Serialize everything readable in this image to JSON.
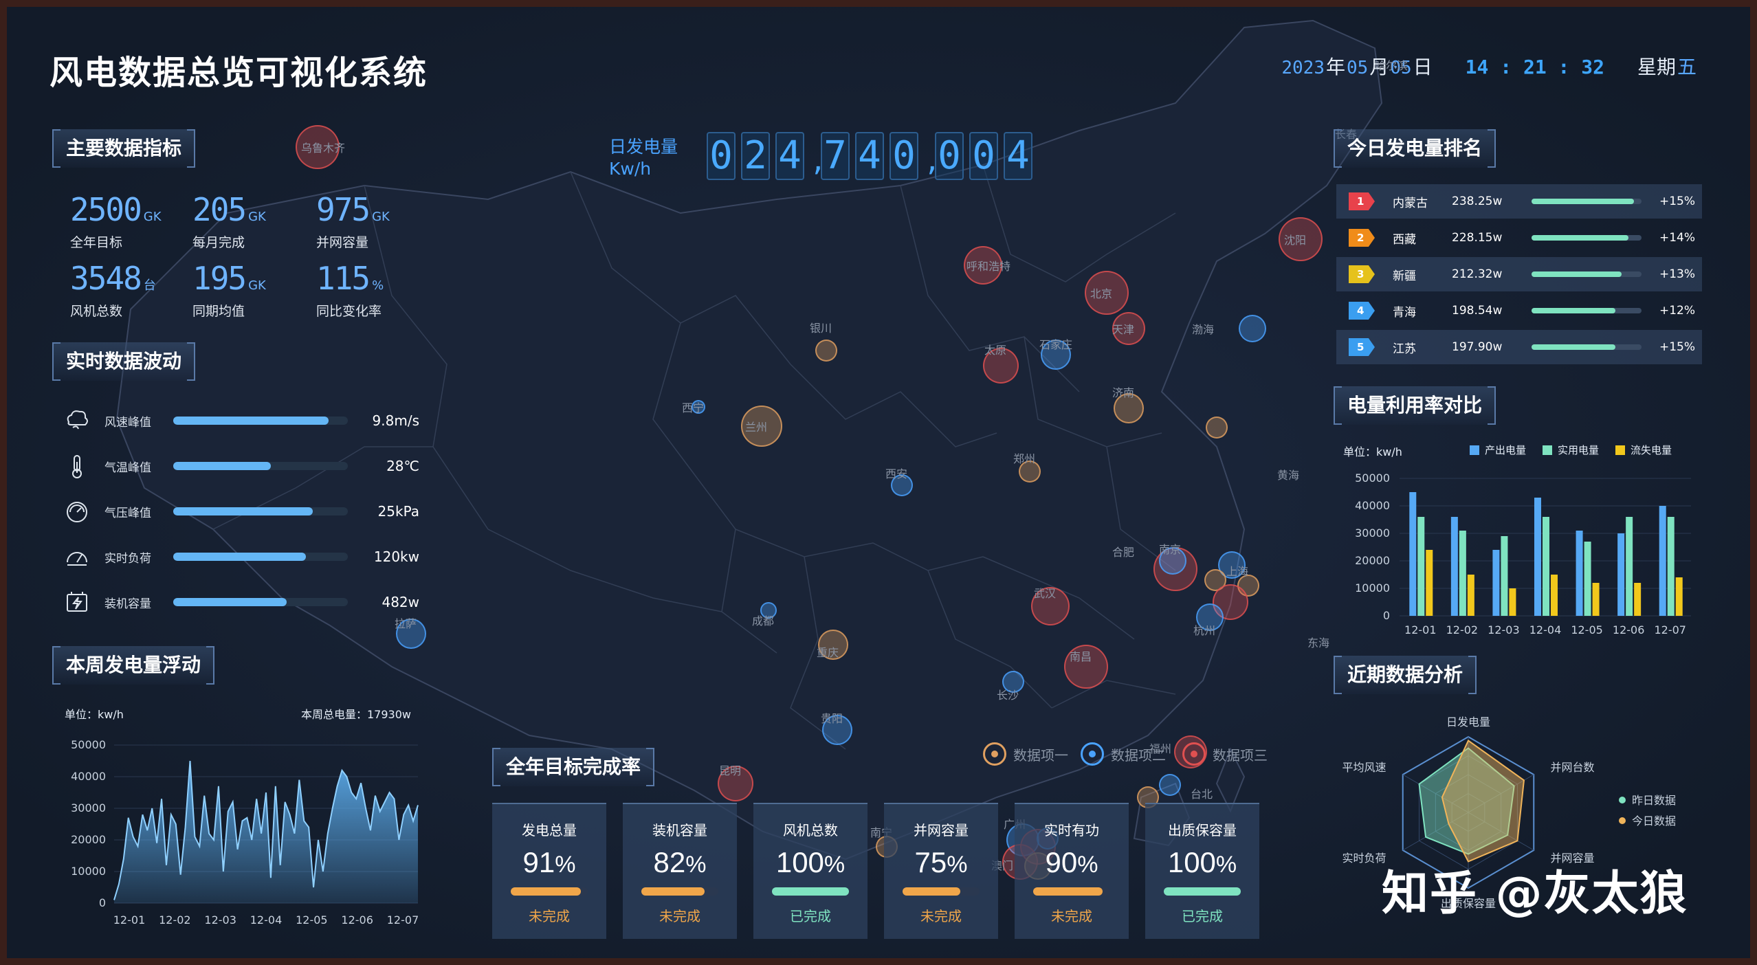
{
  "header": {
    "title": "风电数据总览可视化系统",
    "date": {
      "year": "2023",
      "year_unit": "年",
      "month": "05",
      "month_unit": "月",
      "day": "05",
      "day_unit": "日"
    },
    "time": "14 : 21 : 32",
    "weekday_label": "星期",
    "weekday": "五"
  },
  "main_indicators": {
    "title": "主要数据指标",
    "items": [
      {
        "value": "2500",
        "unit": "GK",
        "label": "全年目标"
      },
      {
        "value": "205",
        "unit": "GK",
        "label": "每月完成"
      },
      {
        "value": "975",
        "unit": "GK",
        "label": "并网容量"
      },
      {
        "value": "3548",
        "unit": "台",
        "label": "风机总数"
      },
      {
        "value": "195",
        "unit": "GK",
        "label": "同期均值"
      },
      {
        "value": "115",
        "unit": "%",
        "label": "同比变化率"
      }
    ]
  },
  "realtime": {
    "title": "实时数据波动",
    "items": [
      {
        "icon": "wind-icon",
        "label": "风速峰值",
        "value": "9.8m/s",
        "level": 0.89
      },
      {
        "icon": "thermometer-icon",
        "label": "气温峰值",
        "value": "28℃",
        "level": 0.56
      },
      {
        "icon": "pressure-gauge-icon",
        "label": "气压峰值",
        "value": "25kPa",
        "level": 0.8
      },
      {
        "icon": "speedometer-icon",
        "label": "实时负荷",
        "value": "120kw",
        "level": 0.76
      },
      {
        "icon": "capacity-icon",
        "label": "装机容量",
        "value": "482w",
        "level": 0.65
      }
    ]
  },
  "weekly": {
    "title": "本周发电量浮动",
    "unit_label": "单位：kw/h",
    "total_label": "本周总电量：17930w",
    "chart_data": {
      "type": "area",
      "x_ticks": [
        "12-01",
        "12-02",
        "12-03",
        "12-04",
        "12-05",
        "12-06",
        "12-07"
      ],
      "y_ticks": [
        "50000",
        "40000",
        "30000",
        "20000",
        "10000",
        "0"
      ],
      "ylim": [
        0,
        50000
      ],
      "values": [
        1000,
        6000,
        14000,
        27000,
        21000,
        18000,
        28000,
        23000,
        30000,
        19000,
        33000,
        12000,
        28000,
        25000,
        9000,
        24000,
        45000,
        21000,
        18000,
        34000,
        22000,
        20000,
        37000,
        10000,
        29000,
        32000,
        17000,
        26000,
        27000,
        20000,
        33000,
        22000,
        35000,
        8000,
        37000,
        12000,
        32000,
        28000,
        22000,
        39000,
        26000,
        24000,
        5000,
        20000,
        10000,
        22000,
        30000,
        37000,
        42000,
        40000,
        35000,
        33000,
        38000,
        30000,
        23000,
        34000,
        29000,
        32000,
        35000,
        33000,
        20000,
        28000,
        31000,
        26000,
        31000
      ]
    }
  },
  "daily_generation": {
    "label_line1": "日发电量",
    "label_line2": "Kw/h",
    "digits": [
      "0",
      "2",
      "4",
      ",",
      "7",
      "4",
      "0",
      ",",
      "0",
      "0",
      "4"
    ]
  },
  "map": {
    "legend": [
      {
        "label": "数据项一",
        "color": "#e0a060"
      },
      {
        "label": "数据项二",
        "color": "#4aa3ff"
      },
      {
        "label": "数据项三",
        "color": "#e05050"
      }
    ],
    "labels": [
      "乌鲁木齐",
      "哈尔滨",
      "长春",
      "沈阳",
      "呼和浩特",
      "北京",
      "天津",
      "渤海",
      "银川",
      "太原",
      "石家庄",
      "济南",
      "西宁",
      "兰州",
      "西安",
      "郑州",
      "黄海",
      "拉萨",
      "成都",
      "南京",
      "合肥",
      "上海",
      "武汉",
      "杭州",
      "东海",
      "重庆",
      "长沙",
      "南昌",
      "贵阳",
      "福州",
      "昆明",
      "台北",
      "南宁",
      "广州",
      "澳门"
    ]
  },
  "annual_target": {
    "title": "全年目标完成率",
    "cards": [
      {
        "name": "发电总量",
        "pct": "91",
        "status": "未完成",
        "done": false,
        "level": 0.91
      },
      {
        "name": "装机容量",
        "pct": "82",
        "status": "未完成",
        "done": false,
        "level": 0.82
      },
      {
        "name": "风机总数",
        "pct": "100",
        "status": "已完成",
        "done": true,
        "level": 1.0
      },
      {
        "name": "并网容量",
        "pct": "75",
        "status": "未完成",
        "done": false,
        "level": 0.75
      },
      {
        "name": "实时有功",
        "pct": "90",
        "status": "未完成",
        "done": false,
        "level": 0.9
      },
      {
        "name": "出质保容量",
        "pct": "100",
        "status": "已完成",
        "done": true,
        "level": 1.0
      }
    ],
    "pct_unit": "%"
  },
  "ranking": {
    "title": "今日发电量排名",
    "rows": [
      {
        "rank": "1",
        "name": "内蒙古",
        "value": "238.25w",
        "pct": "+15%",
        "color": "#e8424b",
        "level": 0.93
      },
      {
        "rank": "2",
        "name": "西藏",
        "value": "228.15w",
        "pct": "+14%",
        "color": "#f08c1a",
        "level": 0.88
      },
      {
        "rank": "3",
        "name": "新疆",
        "value": "212.32w",
        "pct": "+13%",
        "color": "#e6c21c",
        "level": 0.82
      },
      {
        "rank": "4",
        "name": "青海",
        "value": "198.54w",
        "pct": "+12%",
        "color": "#3a9ef0",
        "level": 0.76
      },
      {
        "rank": "5",
        "name": "江苏",
        "value": "197.90w",
        "pct": "+15%",
        "color": "#3a9ef0",
        "level": 0.76
      }
    ]
  },
  "utilization": {
    "title": "电量利用率对比",
    "unit_label": "单位：kw/h",
    "chart_data": {
      "type": "bar",
      "categories": [
        "12-01",
        "12-02",
        "12-03",
        "12-04",
        "12-05",
        "12-06",
        "12-07"
      ],
      "y_ticks": [
        "50000",
        "40000",
        "30000",
        "20000",
        "10000",
        "0"
      ],
      "ylim": [
        0,
        50000
      ],
      "series": [
        {
          "name": "产出电量",
          "color": "#56a9f5",
          "values": [
            45000,
            36000,
            24000,
            43000,
            31000,
            30000,
            40000
          ]
        },
        {
          "name": "实用电量",
          "color": "#7fe3c0",
          "values": [
            36000,
            31000,
            29000,
            36000,
            27000,
            36000,
            36000
          ]
        },
        {
          "name": "流失电量",
          "color": "#f2c81c",
          "values": [
            24000,
            15000,
            10000,
            15000,
            12000,
            12000,
            14000
          ]
        }
      ]
    }
  },
  "recent": {
    "title": "近期数据分析",
    "chart_data": {
      "type": "radar",
      "axes": [
        "日发电量",
        "并网台数",
        "并网容量",
        "出质保容量",
        "实时负荷",
        "平均风速"
      ],
      "series": [
        {
          "name": "昨日数据",
          "color": "#7fe3c0",
          "values": [
            0.85,
            0.7,
            0.6,
            0.55,
            0.65,
            0.75
          ]
        },
        {
          "name": "今日数据",
          "color": "#f0b45a",
          "values": [
            0.95,
            0.85,
            0.75,
            0.65,
            0.3,
            0.4
          ]
        }
      ]
    }
  },
  "watermark": "知乎 @灰太狼"
}
